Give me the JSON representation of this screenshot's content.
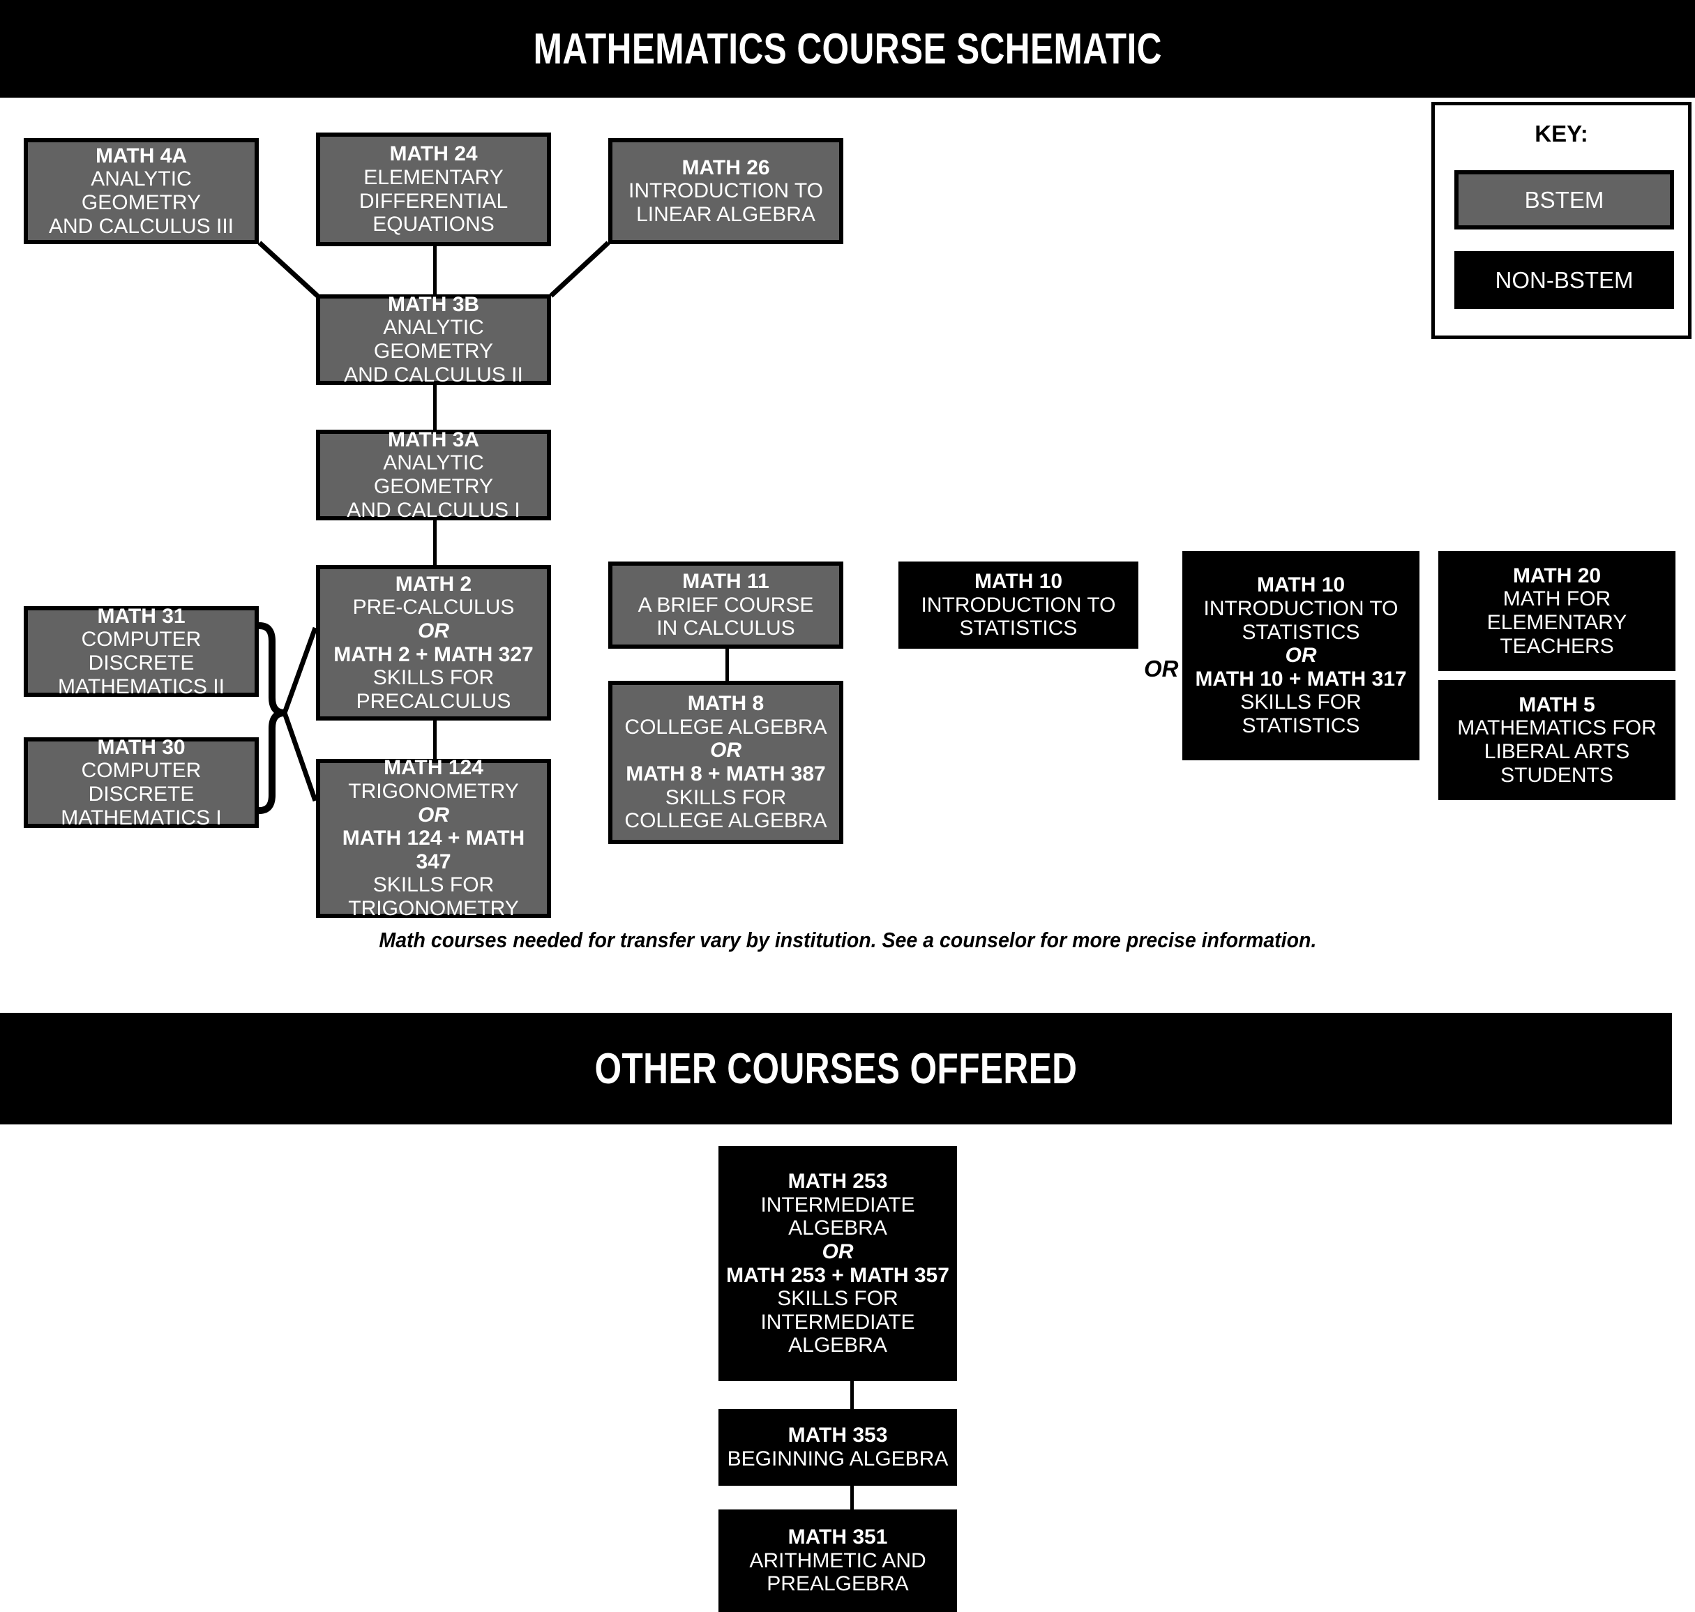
{
  "banners": {
    "top_title": "MATHEMATICS COURSE SCHEMATIC",
    "other_title": "OTHER COURSES OFFERED"
  },
  "key": {
    "title": "KEY:",
    "bstem_label": "BSTEM",
    "nonbstem_label": "NON-BSTEM",
    "bstem_color": "#636363",
    "nonbstem_color": "#000000"
  },
  "footnote": "Math courses needed for transfer vary by institution. See a counselor for more precise information.",
  "or_separator": "OR",
  "courses": {
    "math4a": {
      "code": "MATH 4A",
      "l1": "ANALYTIC GEOMETRY",
      "l2": "AND CALCULUS III",
      "type": "BSTEM"
    },
    "math24": {
      "code": "MATH 24",
      "l1": "ELEMENTARY",
      "l2": "DIFFERENTIAL",
      "l3": "EQUATIONS",
      "type": "BSTEM"
    },
    "math26": {
      "code": "MATH 26",
      "l1": "INTRODUCTION TO",
      "l2": "LINEAR ALGEBRA",
      "type": "BSTEM"
    },
    "math3b": {
      "code": "MATH 3B",
      "l1": "ANALYTIC GEOMETRY",
      "l2": "AND CALCULUS II",
      "type": "BSTEM"
    },
    "math3a": {
      "code": "MATH 3A",
      "l1": "ANALYTIC GEOMETRY",
      "l2": "AND CALCULUS I",
      "type": "BSTEM"
    },
    "math2": {
      "code": "MATH 2",
      "l1": "PRE-CALCULUS",
      "or": "OR",
      "alt": "MATH 2 + MATH 327",
      "l2": "SKILLS FOR",
      "l3": "PRECALCULUS",
      "type": "BSTEM"
    },
    "math124": {
      "code": "MATH 124",
      "l1": "TRIGONOMETRY",
      "or": "OR",
      "alt": "MATH 124 + MATH 347",
      "l2": "SKILLS FOR",
      "l3": "TRIGONOMETRY",
      "type": "BSTEM"
    },
    "math31": {
      "code": "MATH 31",
      "l1": "COMPUTER DISCRETE",
      "l2": "MATHEMATICS II",
      "type": "BSTEM"
    },
    "math30": {
      "code": "MATH 30",
      "l1": "COMPUTER DISCRETE",
      "l2": "MATHEMATICS I",
      "type": "BSTEM"
    },
    "math11": {
      "code": "MATH 11",
      "l1": "A BRIEF COURSE",
      "l2": "IN CALCULUS",
      "type": "BSTEM"
    },
    "math8": {
      "code": "MATH 8",
      "l1": "COLLEGE ALGEBRA",
      "or": "OR",
      "alt": "MATH 8 + MATH 387",
      "l2": "SKILLS FOR",
      "l3": "COLLEGE ALGEBRA",
      "type": "BSTEM"
    },
    "math10a": {
      "code": "MATH 10",
      "l1": "INTRODUCTION TO",
      "l2": "STATISTICS",
      "type": "NON-BSTEM"
    },
    "math10b": {
      "code": "MATH 10",
      "l1": "INTRODUCTION TO",
      "l2": "STATISTICS",
      "or": "OR",
      "alt": "MATH 10 + MATH 317",
      "l3": "SKILLS FOR",
      "l4": "STATISTICS",
      "type": "NON-BSTEM"
    },
    "math20": {
      "code": "MATH 20",
      "l1": "MATH FOR",
      "l2": "ELEMENTARY",
      "l3": "TEACHERS",
      "type": "NON-BSTEM"
    },
    "math5": {
      "code": "MATH 5",
      "l1": "MATHEMATICS FOR",
      "l2": "LIBERAL ARTS",
      "l3": "STUDENTS",
      "type": "NON-BSTEM"
    },
    "math253": {
      "code": "MATH 253",
      "l1": "INTERMEDIATE",
      "l2": "ALGEBRA",
      "or": "OR",
      "alt": "MATH 253 + MATH 357",
      "l3": "SKILLS FOR",
      "l4": "INTERMEDIATE",
      "l5": "ALGEBRA",
      "type": "NON-BSTEM"
    },
    "math353": {
      "code": "MATH 353",
      "l1": "BEGINNING ALGEBRA",
      "type": "NON-BSTEM"
    },
    "math351": {
      "code": "MATH 351",
      "l1": "ARITHMETIC AND",
      "l2": "PREALGEBRA",
      "type": "NON-BSTEM"
    }
  }
}
